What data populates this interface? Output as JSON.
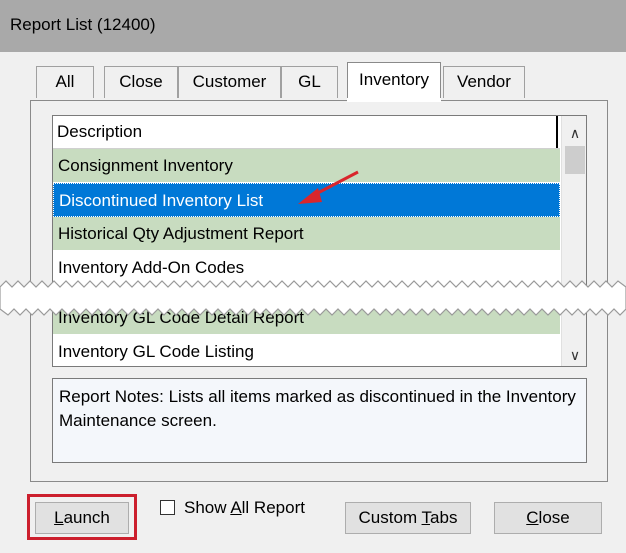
{
  "window": {
    "title": "Report List (12400)"
  },
  "tabs": [
    {
      "label": "All",
      "active": false
    },
    {
      "label": "Close",
      "active": false
    },
    {
      "label": "Customer",
      "active": false
    },
    {
      "label": "GL",
      "active": false
    },
    {
      "label": "Inventory",
      "active": true
    },
    {
      "label": "Vendor",
      "active": false
    }
  ],
  "list": {
    "header": "Description",
    "rows": [
      {
        "label": "Consignment Inventory",
        "style": "green"
      },
      {
        "label": "Discontinued Inventory List",
        "style": "selected"
      },
      {
        "label": "Historical Qty Adjustment Report",
        "style": "green"
      },
      {
        "label": "Inventory Add-On Codes",
        "style": "white"
      },
      {
        "label": "Inventory GL Code Detail Report",
        "style": "green"
      },
      {
        "label": "Inventory GL Code Listing",
        "style": "white"
      }
    ]
  },
  "notes": {
    "text": "Report Notes:  Lists all items marked as discontinued in the Inventory Maintenance screen."
  },
  "footer": {
    "launch_label_pre": "",
    "launch_label_ul": "L",
    "launch_label_post": "aunch",
    "show_all_pre": "Show ",
    "show_all_ul": "A",
    "show_all_post": "ll Report",
    "custom_tabs_pre": "Custom ",
    "custom_tabs_ul": "T",
    "custom_tabs_post": "abs",
    "close_ul": "C",
    "close_post": "lose"
  },
  "colors": {
    "highlight": "#cc1f2d",
    "selected_row": "#0078d7",
    "green_row": "#c8dcc0",
    "arrow": "#d9262c"
  }
}
